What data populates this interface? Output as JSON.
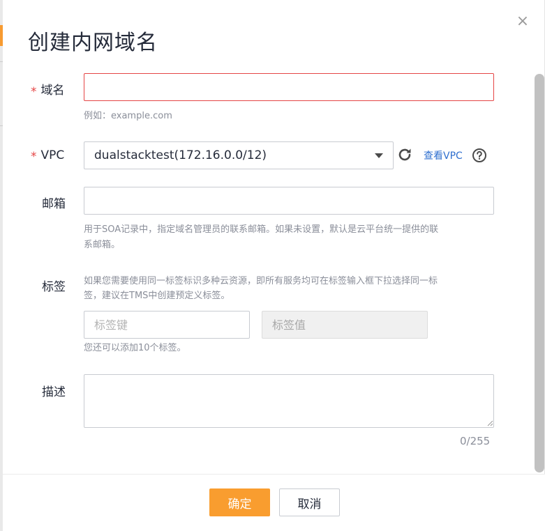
{
  "dialog": {
    "title": "创建内网域名",
    "close_symbol": "×"
  },
  "domain": {
    "required_mark": "*",
    "label": "域名",
    "value": "",
    "placeholder": "",
    "hint": "例如：example.com"
  },
  "vpc": {
    "required_mark": "*",
    "label": "VPC",
    "selected": "dualstacktest(172.16.0.0/12)",
    "view_link": "查看VPC",
    "refresh_icon": "refresh-icon",
    "help_icon": "help-icon"
  },
  "email": {
    "label": "邮箱",
    "value": "",
    "hint_line1": "用于SOA记录中，指定域名管理员的联系邮箱。如果未设置，默认是云平台统一提供的联",
    "hint_line2": "系邮箱。"
  },
  "tags": {
    "label": "标签",
    "desc_line1": "如果您需要使用同一标签标识多种云资源，即所有服务均可在标签输入框下拉选择同一标",
    "desc_line2": "签，建议在TMS中创建预定义标签。",
    "key_placeholder": "标签键",
    "value_placeholder": "标签值",
    "remaining": "您还可以添加10个标签。"
  },
  "description": {
    "label": "描述",
    "value": "",
    "counter": "0/255"
  },
  "footer": {
    "ok_label": "确定",
    "cancel_label": "取消"
  },
  "colors": {
    "accent": "#f99d2f",
    "error": "#e54545",
    "link": "#2f6fcf"
  }
}
